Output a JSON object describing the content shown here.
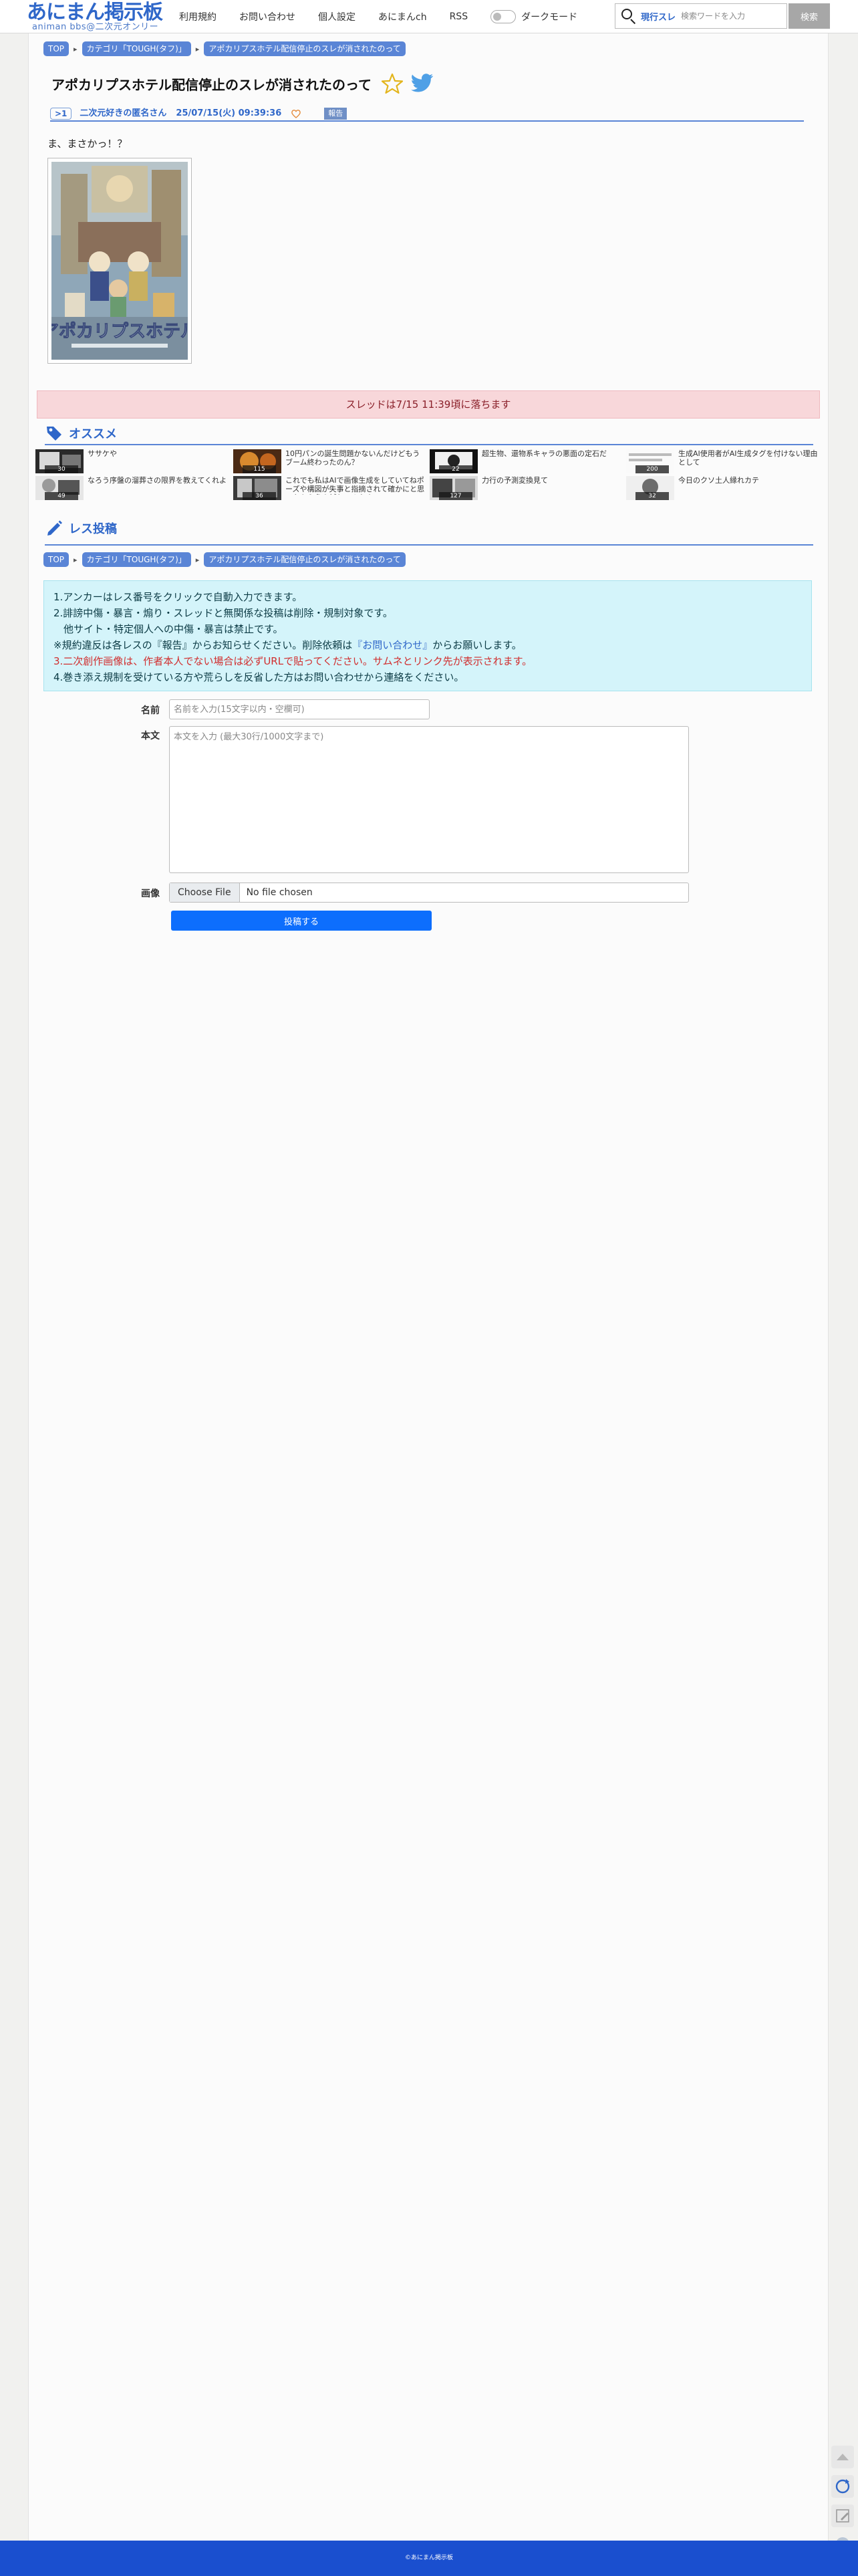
{
  "header": {
    "logo_main": "あにまん掲示板",
    "logo_sub": "animan bbs@二次元オンリー",
    "nav": [
      "利用規約",
      "お問い合わせ",
      "個人設定",
      "あにまんch",
      "RSS"
    ],
    "dark_mode_label": "ダークモード",
    "search_scope": "現行スレ",
    "search_placeholder": "検索ワードを入力",
    "search_button": "検索"
  },
  "breadcrumb": [
    "TOP",
    "カテゴリ「TOUGH(タフ)」",
    "アポカリプスホテル配信停止のスレが消されたのって"
  ],
  "thread": {
    "title": "アポカリプスホテル配信停止のスレが消されたのって",
    "post": {
      "number": ">1",
      "author": "二次元好きの匿名さん",
      "date": "25/07/15(火) 09:39:36",
      "report_label": "報告",
      "body": "ま、まさかっ！？"
    },
    "dropped_notice": "スレッドは7/15 11:39頃に落ちます"
  },
  "recommend": {
    "heading": "オススメ",
    "items": [
      {
        "title": "ササケや",
        "count": "30"
      },
      {
        "title": "10円パンの誕生問題かないんだけどもうブーム終わったのん？",
        "count": "115"
      },
      {
        "title": "超生物、還物系キャラの悪面の定石だ",
        "count": "22"
      },
      {
        "title": "生成AI使用者がAI生成タグを付けない理由として",
        "count": "200"
      },
      {
        "title": "なろう序盤の溜葬さの限界を教えてくれよ",
        "count": "49"
      },
      {
        "title": "これでも私はAIで画像生成をしていてねポーズや構図が失事と指摘されて確かにと思ったから色々試してみたよ",
        "count": "36"
      },
      {
        "title": "力行の予測変換見て",
        "count": "127"
      },
      {
        "title": "今日のクソ土人縁れカテ",
        "count": "32"
      }
    ]
  },
  "reply": {
    "heading": "レス投稿",
    "notice": [
      "1.アンカーはレス番号をクリックで自動入力できます。",
      "2.誹謗中傷・暴言・煽り・スレッドと無関係な投稿は削除・規制対象です。",
      "　他サイト・特定個人への中傷・暴言は禁止です。",
      "※規約違反は各レスの『報告』からお知らせください。削除依頼は",
      "3.二次創作画像は、作者本人でない場合は必ずURLで貼ってください。サムネとリンク先が表示されます。",
      "4.巻き添え規制を受けている方や荒らしを反省した方はお問い合わせから連絡をください。"
    ],
    "notice_link": "『お問い合わせ』",
    "notice_tail": "からお願いします。",
    "name_label": "名前",
    "name_placeholder": "名前を入力(15文字以内・空欄可)",
    "body_label": "本文",
    "body_placeholder": "本文を入力 (最大30行/1000文字まで)",
    "image_label": "画像",
    "file_button": "Choose File",
    "file_status": "No file chosen",
    "submit": "投稿する"
  },
  "footer": {
    "copyright": "©あにまん掲示板"
  },
  "colors": {
    "accent": "#2f67c9",
    "crumb": "#5a85d6",
    "notice_bg": "#d4f4fa",
    "danger_bg": "#f8d7da",
    "submit": "#0d6efd",
    "footer": "#1a4fcf"
  },
  "icons": [
    "search-icon",
    "star-icon",
    "twitter-icon",
    "heart-icon",
    "tag-icon",
    "pencil-icon",
    "chat-icon",
    "arrow-up-icon",
    "reload-icon",
    "edit-icon",
    "gear-icon"
  ]
}
